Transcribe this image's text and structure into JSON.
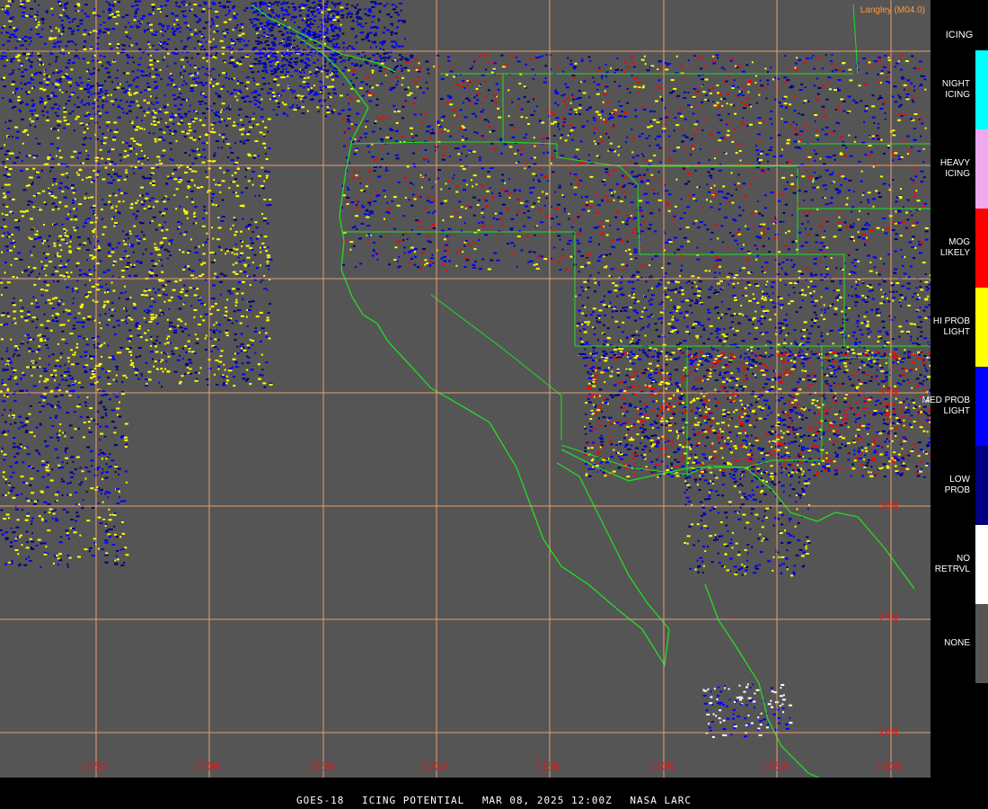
{
  "credit": "Langley (M04.0)",
  "legend": {
    "title": "ICING",
    "items": [
      {
        "label": "NIGHT\nICING",
        "color": "#00ffff"
      },
      {
        "label": "HEAVY\nICING",
        "color": "#eeaaee"
      },
      {
        "label": "MOG\nLIKELY",
        "color": "#ff0000"
      },
      {
        "label": "HI PROB\nLIGHT",
        "color": "#ffff00"
      },
      {
        "label": "MED PROB\nLIGHT",
        "color": "#0000ff"
      },
      {
        "label": "LOW\nPROB",
        "color": "#000080"
      },
      {
        "label": "NO\nRETRVL",
        "color": "#ffffff"
      },
      {
        "label": "NONE",
        "color": "#555555"
      }
    ]
  },
  "longitudes": [
    "135W",
    "130W",
    "125W",
    "120W",
    "115W",
    "110W",
    "105W",
    "100W"
  ],
  "latitudes": [
    "35N",
    "30N",
    "25N",
    "20N"
  ],
  "footer": {
    "satellite": "GOES-18",
    "product": "ICING POTENTIAL",
    "datetime": "MAR 08, 2025 12:00Z",
    "agency": "NASA LARC"
  },
  "colors": {
    "grid": "#e8a070",
    "border": "#22dd22",
    "label": "#cc2222"
  }
}
